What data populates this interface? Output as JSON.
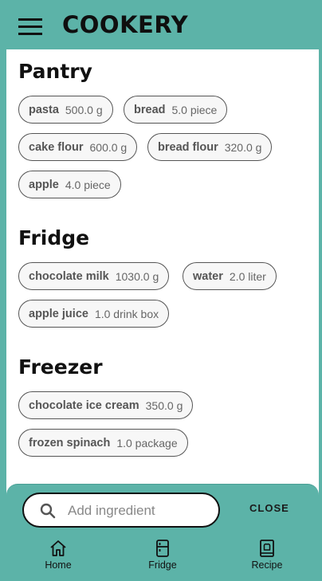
{
  "app": {
    "title": "COOKERY"
  },
  "sections": [
    {
      "title": "Pantry",
      "items": [
        {
          "name": "pasta",
          "qty": "500.0 g"
        },
        {
          "name": "bread",
          "qty": "5.0 piece"
        },
        {
          "name": "cake flour",
          "qty": "600.0 g"
        },
        {
          "name": "bread flour",
          "qty": "320.0 g"
        },
        {
          "name": "apple",
          "qty": "4.0 piece"
        }
      ]
    },
    {
      "title": "Fridge",
      "items": [
        {
          "name": "chocolate milk",
          "qty": "1030.0 g"
        },
        {
          "name": "water",
          "qty": "2.0 liter"
        },
        {
          "name": "apple juice",
          "qty": "1.0 drink box"
        }
      ]
    },
    {
      "title": "Freezer",
      "items": [
        {
          "name": "chocolate ice cream",
          "qty": "350.0 g"
        },
        {
          "name": "frozen spinach",
          "qty": "1.0 package"
        }
      ]
    }
  ],
  "search": {
    "placeholder": "Add ingredient",
    "close_label": "CLOSE"
  },
  "nav": {
    "home": "Home",
    "fridge": "Fridge",
    "recipe": "Recipe"
  },
  "colors": {
    "accent": "#5cb3a8",
    "chip_border": "#555555",
    "background": "#ffffff"
  },
  "icons": {
    "menu": "hamburger-icon",
    "search": "search-icon",
    "home": "home-icon",
    "fridge": "fridge-icon",
    "recipe": "recipe-book-icon"
  }
}
